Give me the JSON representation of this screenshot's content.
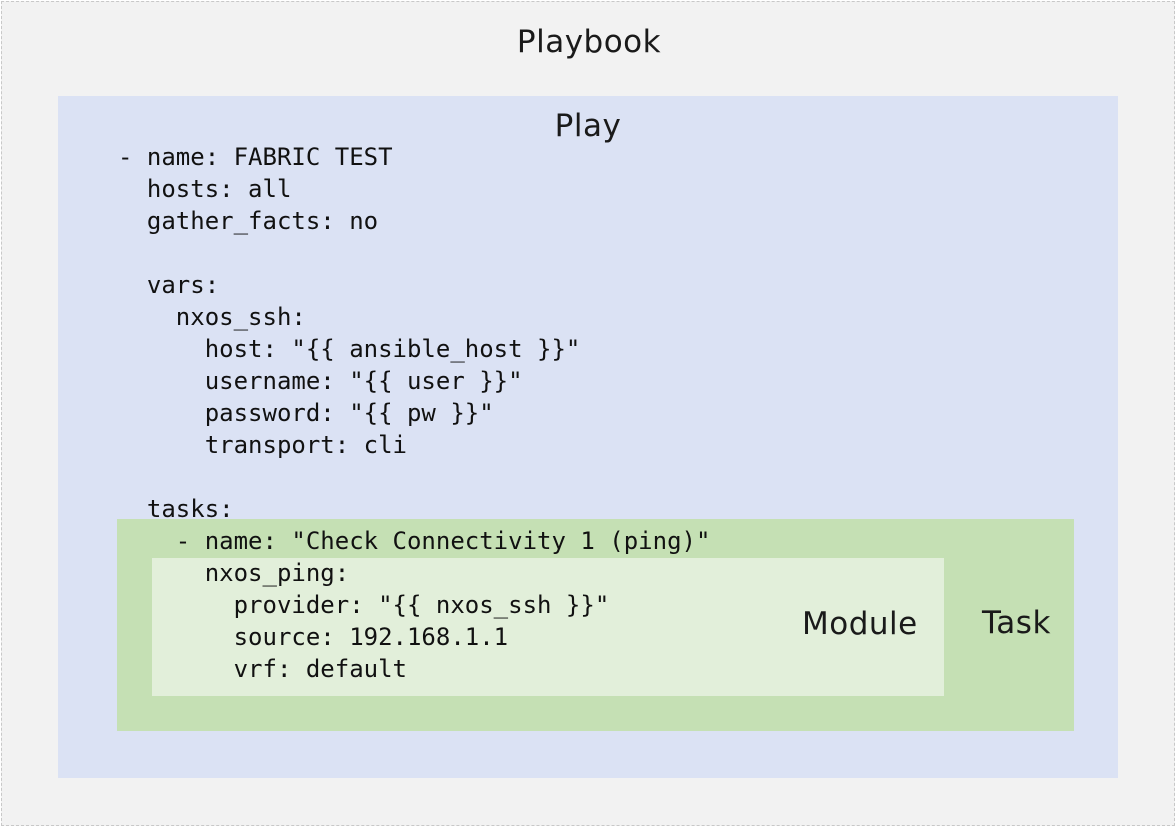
{
  "diagram": {
    "playbook_label": "Playbook",
    "play_label": "Play",
    "task_label": "Task",
    "module_label": "Module"
  },
  "code": {
    "lines": [
      "- name: FABRIC TEST",
      "  hosts: all",
      "  gather_facts: no",
      "",
      "  vars:",
      "    nxos_ssh:",
      "      host: \"{{ ansible_host }}\"",
      "      username: \"{{ user }}\"",
      "      password: \"{{ pw }}\"",
      "      transport: cli",
      "",
      "  tasks:",
      "    - name: \"Check Connectivity 1 (ping)\"",
      "      nxos_ping:",
      "        provider: \"{{ nxos_ssh }}\"",
      "        source: 192.168.1.1",
      "        vrf: default"
    ]
  },
  "colors": {
    "playbook_bg": "#f2f2f2",
    "play_bg": "#dbe2f4",
    "task_bg": "#c5e0b4",
    "module_bg": "#e2efda"
  }
}
